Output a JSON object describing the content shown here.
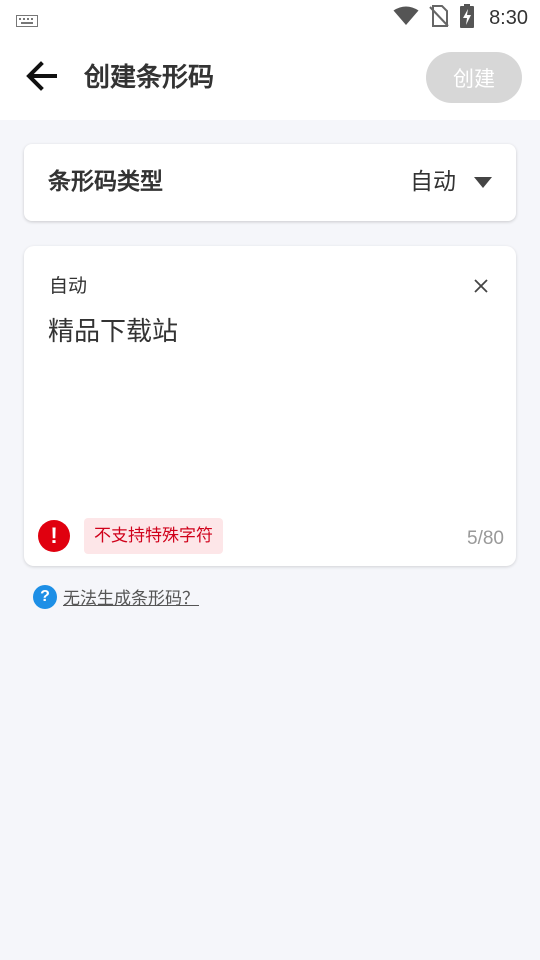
{
  "status_bar": {
    "time": "8:30",
    "icons": [
      "keyboard-icon",
      "wifi-icon",
      "no-sim-icon",
      "battery-charging-icon"
    ]
  },
  "app_bar": {
    "back_icon": "arrow-left-icon",
    "title": "创建条形码",
    "create_button": "创建"
  },
  "barcode_type": {
    "label": "条形码类型",
    "value": "自动",
    "dropdown_icon": "triangle-down-icon"
  },
  "input": {
    "label": "自动",
    "value": "精品下载站",
    "clear_icon": "close-icon",
    "error_icon_glyph": "!",
    "error_message": "不支持特殊字符",
    "char_count": "5/80"
  },
  "help": {
    "icon_glyph": "?",
    "link_text": "无法生成条形码？"
  },
  "colors": {
    "error_red": "#e0000f",
    "error_badge_bg": "#fde6e8",
    "help_blue": "#1d8fe6",
    "disabled_button": "#d7d7d7"
  }
}
